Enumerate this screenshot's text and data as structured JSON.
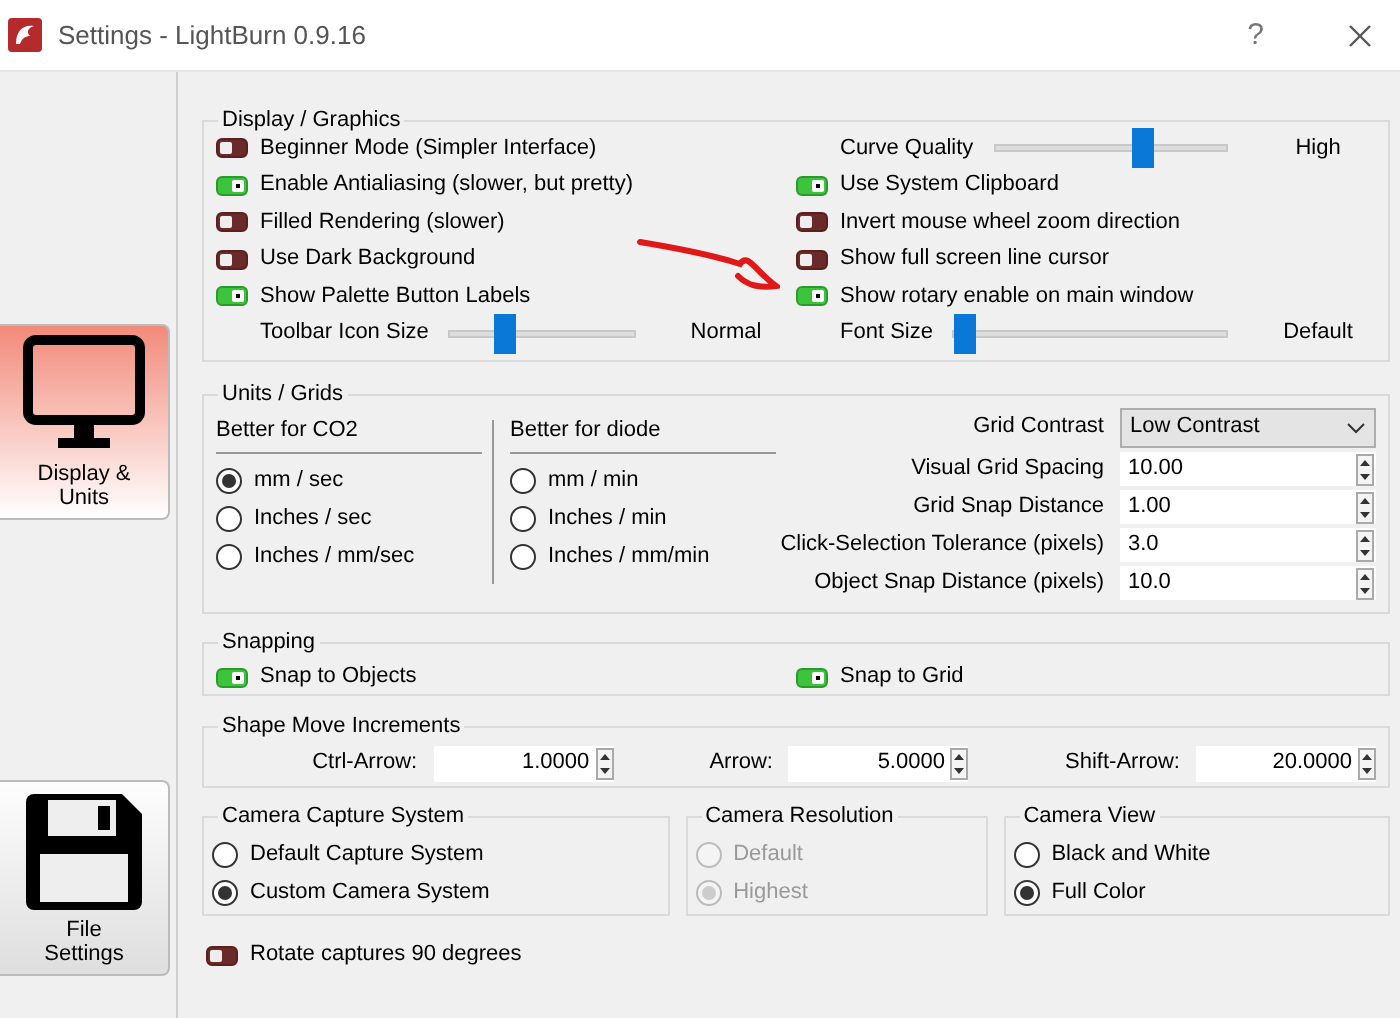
{
  "window": {
    "title": "Settings - LightBurn 0.9.16",
    "help": "?"
  },
  "sidebar": [
    {
      "label": "Display & Units",
      "selected": true
    },
    {
      "label": "File Settings",
      "selected": false
    }
  ],
  "display_graphics": {
    "title": "Display / Graphics",
    "items": [
      {
        "kind": "toggle",
        "label": "Beginner Mode (Simpler Interface)",
        "on": false
      },
      {
        "kind": "slider",
        "label": "Curve Quality",
        "level": 0.64,
        "value": "High"
      },
      {
        "kind": "toggle",
        "label": "Enable Antialiasing (slower, but pretty)",
        "on": true
      },
      {
        "kind": "toggle",
        "label": "Use System Clipboard",
        "on": true
      },
      {
        "kind": "toggle",
        "label": "Filled Rendering (slower)",
        "on": false
      },
      {
        "kind": "toggle",
        "label": "Invert mouse wheel zoom direction",
        "on": false
      },
      {
        "kind": "toggle",
        "label": "Use Dark Background",
        "on": false
      },
      {
        "kind": "toggle",
        "label": "Show full screen line cursor",
        "on": false
      },
      {
        "kind": "toggle",
        "label": "Show Palette Button Labels",
        "on": true
      },
      {
        "kind": "toggle",
        "label": "Show rotary enable on main window",
        "on": true
      },
      {
        "kind": "slider",
        "label": "Toolbar Icon Size",
        "level": 0.29,
        "value": "Normal"
      },
      {
        "kind": "slider",
        "label": "Font Size",
        "level": 0.03,
        "value": "Default"
      }
    ]
  },
  "units_grids": {
    "title": "Units / Grids",
    "columns": [
      {
        "heading": "Better for CO2",
        "options": [
          {
            "label": "mm / sec",
            "selected": true
          },
          {
            "label": "Inches / sec",
            "selected": false
          },
          {
            "label": "Inches / mm/sec",
            "selected": false
          }
        ]
      },
      {
        "heading": "Better for diode",
        "options": [
          {
            "label": "mm / min",
            "selected": false
          },
          {
            "label": "Inches / min",
            "selected": false
          },
          {
            "label": "Inches / mm/min",
            "selected": false
          }
        ]
      }
    ],
    "grid_contrast": {
      "label": "Grid Contrast",
      "value": "Low Contrast"
    },
    "fields": [
      {
        "label": "Visual Grid Spacing",
        "value": "10.00"
      },
      {
        "label": "Grid Snap Distance",
        "value": "1.00"
      },
      {
        "label": "Click-Selection Tolerance (pixels)",
        "value": "3.0"
      },
      {
        "label": "Object Snap Distance (pixels)",
        "value": "10.0"
      }
    ]
  },
  "snapping": {
    "title": "Snapping",
    "toggles": [
      {
        "label": "Snap to Objects",
        "on": true
      },
      {
        "label": "Snap to Grid",
        "on": true
      }
    ]
  },
  "shape_move": {
    "title": "Shape Move Increments",
    "fields": [
      {
        "label": "Ctrl-Arrow:",
        "value": "1.0000"
      },
      {
        "label": "Arrow:",
        "value": "5.0000"
      },
      {
        "label": "Shift-Arrow:",
        "value": "20.0000"
      }
    ]
  },
  "camera_groups": [
    {
      "title": "Camera Capture System",
      "options": [
        {
          "label": "Default Capture System",
          "selected": false,
          "disabled": false
        },
        {
          "label": "Custom Camera System",
          "selected": true,
          "disabled": false
        }
      ]
    },
    {
      "title": "Camera Resolution",
      "options": [
        {
          "label": "Default",
          "selected": false,
          "disabled": true
        },
        {
          "label": "Highest",
          "selected": true,
          "disabled": true
        }
      ]
    },
    {
      "title": "Camera View",
      "options": [
        {
          "label": "Black and White",
          "selected": false,
          "disabled": false
        },
        {
          "label": "Full Color",
          "selected": true,
          "disabled": false
        }
      ]
    }
  ],
  "rotate_toggle": {
    "label": "Rotate captures 90 degrees",
    "on": false
  }
}
